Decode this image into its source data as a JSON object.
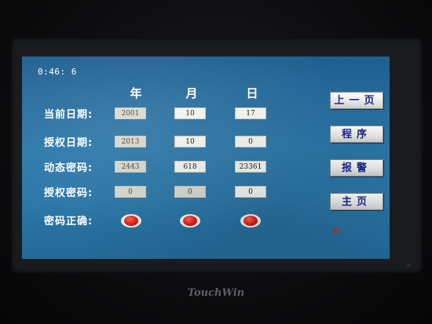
{
  "clock": "0:46: 6",
  "columns": {
    "year": "年",
    "month": "月",
    "day": "日"
  },
  "rows": {
    "current_date": {
      "label": "当前日期:",
      "year": "2001",
      "month": "10",
      "day": "17"
    },
    "auth_date": {
      "label": "授权日期:",
      "year": "2013",
      "month": "10",
      "day": "0"
    },
    "dynamic_pwd": {
      "label": "动态密码:",
      "year": "2443",
      "month": "618",
      "day": "23361"
    },
    "auth_pwd": {
      "label": "授权密码:",
      "year": "0",
      "month": "0",
      "day": "0"
    }
  },
  "password_ok": {
    "label": "密码正确:",
    "indicators": [
      "red",
      "red",
      "red"
    ]
  },
  "buttons": {
    "prev_page": "上一页",
    "program": "程序",
    "alarm": "报警",
    "home": "主页"
  },
  "version": {
    "label": "V:"
  },
  "brand": "TouchWin",
  "colors": {
    "screen_bg": "#2a77a8",
    "button_text": "#1a2a8a",
    "lamp_red": "#e11b12",
    "version_red": "#e02020"
  }
}
